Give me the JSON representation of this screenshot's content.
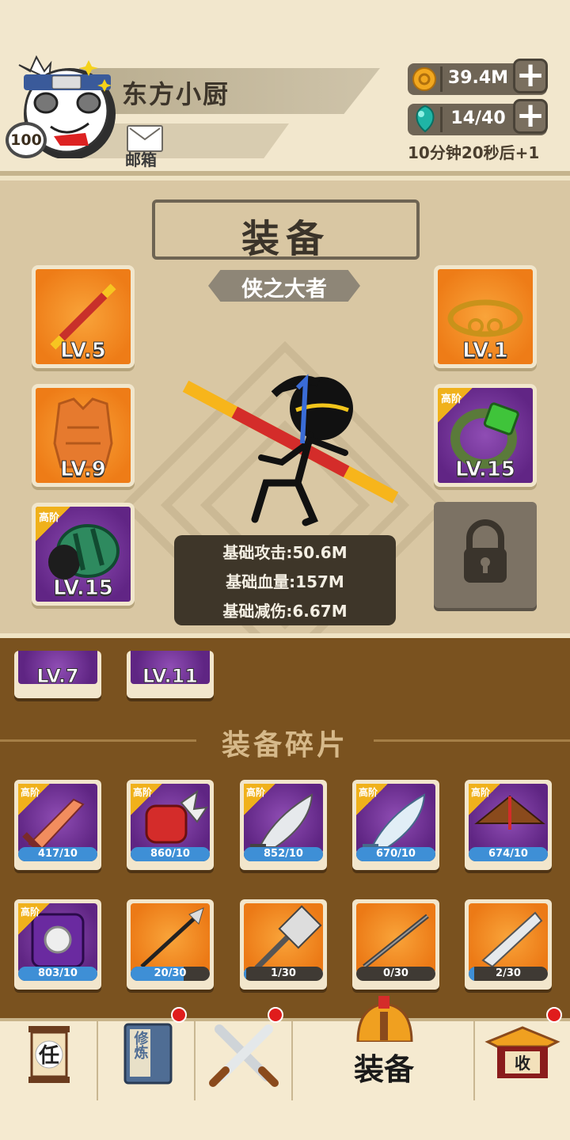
{
  "player": {
    "name": "东方小厨",
    "level": "100",
    "mail_label": "邮箱"
  },
  "resources": {
    "coins": "39.4M",
    "energy": "14/40",
    "timer": "10分钟20秒后+1"
  },
  "equipment": {
    "title": "装备",
    "subtitle": "侠之大者",
    "slots": [
      {
        "level": "LV.5",
        "rarity": "orange",
        "tag": ""
      },
      {
        "level": "LV.9",
        "rarity": "orange",
        "tag": ""
      },
      {
        "level": "LV.15",
        "rarity": "purple",
        "tag": "高阶"
      },
      {
        "level": "LV.1",
        "rarity": "orange",
        "tag": ""
      },
      {
        "level": "LV.15",
        "rarity": "purple",
        "tag": "高阶"
      }
    ],
    "stats": [
      "基础攻击:50.6M",
      "基础血量:157M",
      "基础减伤:6.67M"
    ]
  },
  "inventory": {
    "partial_items": [
      "LV.7",
      "LV.11"
    ],
    "shards_title": "装备碎片",
    "shards": [
      {
        "progress": "417/10",
        "fraction": 1.0,
        "rarity": "purple",
        "tag": "高阶"
      },
      {
        "progress": "860/10",
        "fraction": 1.0,
        "rarity": "purple",
        "tag": "高阶"
      },
      {
        "progress": "852/10",
        "fraction": 1.0,
        "rarity": "purple",
        "tag": "高阶"
      },
      {
        "progress": "670/10",
        "fraction": 1.0,
        "rarity": "purple",
        "tag": "高阶"
      },
      {
        "progress": "674/10",
        "fraction": 1.0,
        "rarity": "purple",
        "tag": "高阶"
      },
      {
        "progress": "803/10",
        "fraction": 1.0,
        "rarity": "purple",
        "tag": "高阶"
      },
      {
        "progress": "20/30",
        "fraction": 0.667,
        "rarity": "orange",
        "tag": ""
      },
      {
        "progress": "1/30",
        "fraction": 0.033,
        "rarity": "orange",
        "tag": ""
      },
      {
        "progress": "0/30",
        "fraction": 0.0,
        "rarity": "orange",
        "tag": ""
      },
      {
        "progress": "2/30",
        "fraction": 0.067,
        "rarity": "orange",
        "tag": ""
      }
    ]
  },
  "nav": {
    "task_glyph": "任",
    "train_glyph": "修炼",
    "collect_glyph": "收",
    "active_label": "装备"
  },
  "colors": {
    "orange": "#ee7c17",
    "purple": "#612585",
    "badge_red": "#e01c1c",
    "progress_blue": "#3e8fd6"
  }
}
